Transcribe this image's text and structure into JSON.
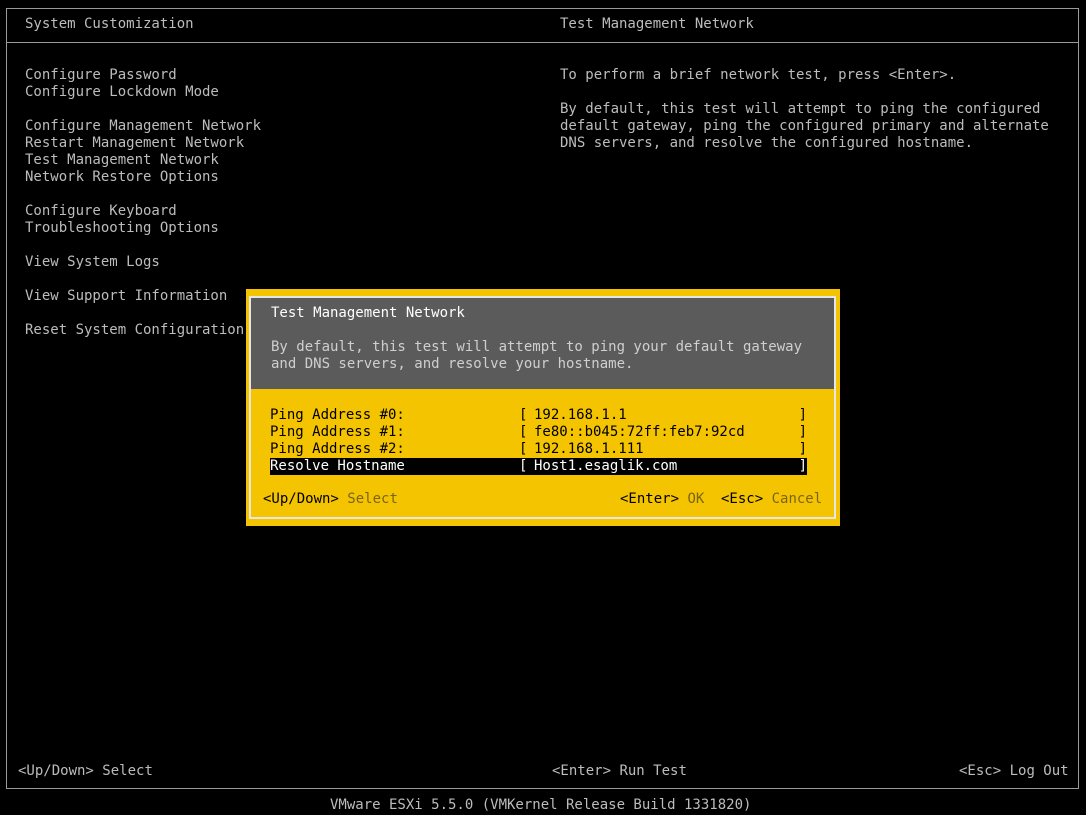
{
  "header": {
    "left_title": "System Customization",
    "right_title": "Test Management Network"
  },
  "menu": {
    "groups": [
      [
        "Configure Password",
        "Configure Lockdown Mode"
      ],
      [
        "Configure Management Network",
        "Restart Management Network",
        "Test Management Network",
        "Network Restore Options"
      ],
      [
        "Configure Keyboard",
        "Troubleshooting Options"
      ],
      [
        "View System Logs"
      ],
      [
        "View Support Information"
      ],
      [
        "Reset System Configuration"
      ]
    ]
  },
  "description": {
    "line1": "To perform a brief network test, press <Enter>.",
    "para2": [
      "By default, this test will attempt to ping the configured",
      "default gateway, ping the configured primary and alternate",
      "DNS servers, and resolve the configured hostname."
    ]
  },
  "dialog": {
    "title": "Test Management Network",
    "text": [
      "By default, this test will attempt to ping your default gateway",
      "and DNS servers, and resolve your hostname."
    ],
    "fields": [
      {
        "label": "Ping Address #0:",
        "value": "192.168.1.1"
      },
      {
        "label": "Ping Address #1:",
        "value": "fe80::b045:72ff:feb7:92cd"
      },
      {
        "label": "Ping Address #2:",
        "value": "192.168.1.111"
      },
      {
        "label": "Resolve Hostname",
        "value": "Host1.esaglik.com"
      }
    ],
    "keys": {
      "updown_key": "<Up/Down>",
      "updown_action": "Select",
      "enter_key": "<Enter>",
      "enter_action": "OK",
      "esc_key": "<Esc>",
      "esc_action": "Cancel"
    }
  },
  "footer": {
    "left_key": "<Up/Down>",
    "left_action": "Select",
    "center_key": "<Enter>",
    "center_action": "Run Test",
    "right_key": "<Esc>",
    "right_action": "Log Out"
  },
  "status_bar": "VMware ESXi 5.5.0 (VMKernel Release Build 1331820)"
}
